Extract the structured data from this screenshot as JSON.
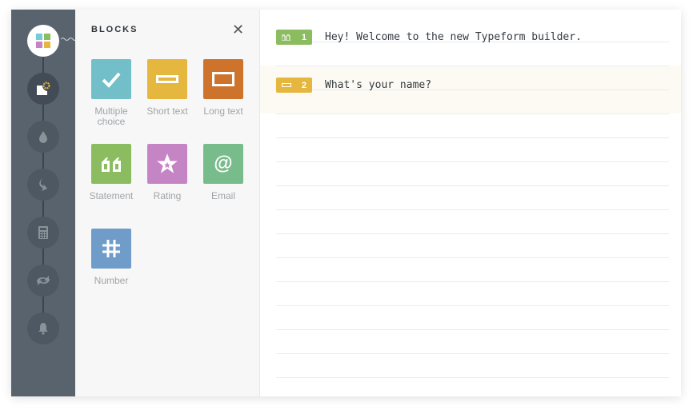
{
  "blocks_panel": {
    "title": "BLOCKS",
    "close_icon": "close-icon",
    "items": [
      {
        "label": "Multiple choice",
        "icon": "checkmark-icon",
        "color": "#72bfc9"
      },
      {
        "label": "Short text",
        "icon": "short-text-icon",
        "color": "#e5b73e"
      },
      {
        "label": "Long text",
        "icon": "long-text-icon",
        "color": "#cd732c"
      },
      {
        "label": "Statement",
        "icon": "quote-icon",
        "color": "#8bbc60"
      },
      {
        "label": "Rating",
        "icon": "star-icon",
        "color": "#c585c5"
      },
      {
        "label": "Email",
        "icon": "at-icon",
        "color": "#78bc8c"
      },
      {
        "label": "Number",
        "icon": "hash-icon",
        "color": "#6f9cc8"
      }
    ]
  },
  "sidebar": {
    "items": [
      "blocks-icon",
      "settings-icon",
      "design-icon",
      "logic-icon",
      "calculator-icon",
      "integrations-icon",
      "notifications-icon"
    ]
  },
  "questions": [
    {
      "number": "1",
      "text": "Hey! Welcome to the new Typeform builder.",
      "color": "#8bbc60",
      "icon": "quote-icon"
    },
    {
      "number": "2",
      "text": "What's your name?",
      "color": "#e5b73e",
      "icon": "short-text-icon"
    }
  ]
}
